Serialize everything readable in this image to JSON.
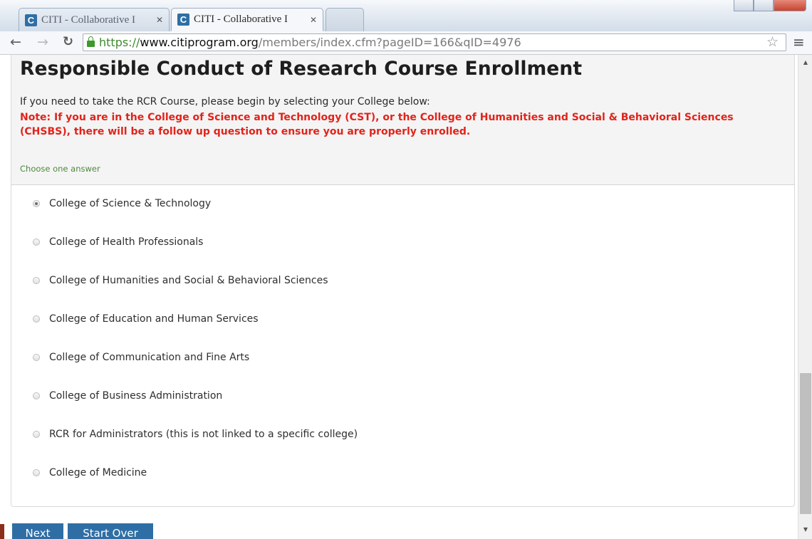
{
  "browser": {
    "tabs": [
      {
        "title": "CITI - Collaborative I",
        "favicon": "C"
      },
      {
        "title": "CITI - Collaborative I",
        "favicon": "C"
      }
    ],
    "url": {
      "scheme": "https://",
      "host": "www.citiprogram.org",
      "path": "/members/index.cfm?pageID=166&qID=4976"
    }
  },
  "page": {
    "title": "Responsible Conduct of Research Course Enrollment",
    "intro": "If you need to take the RCR Course, please begin by selecting your College below:",
    "note": "Note: If you are in the College of Science and Technology (CST), or the College of Humanities and Social & Behavioral Sciences (CHSBS), there will be a follow up question to ensure you are properly enrolled.",
    "choose_label": "Choose one answer",
    "options": [
      {
        "label": "College of Science & Technology",
        "checked": true
      },
      {
        "label": "College of Health Professionals",
        "checked": false
      },
      {
        "label": "College of Humanities and Social & Behavioral Sciences",
        "checked": false
      },
      {
        "label": "College of Education and Human Services",
        "checked": false
      },
      {
        "label": "College of Communication and Fine Arts",
        "checked": false
      },
      {
        "label": "College of Business Administration",
        "checked": false
      },
      {
        "label": "RCR for Administrators (this is not linked to a specific college)",
        "checked": false
      },
      {
        "label": "College of Medicine",
        "checked": false
      }
    ],
    "buttons": {
      "next": "Next",
      "start_over": "Start Over"
    }
  },
  "colors": {
    "note_red": "#e2231a",
    "button_blue": "#2f6ea5",
    "choose_green": "#4c8a3d"
  }
}
